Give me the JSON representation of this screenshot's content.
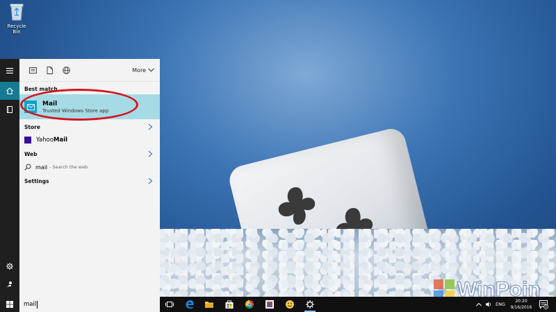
{
  "desktop": {
    "recycle_bin_label": "Recycle Bin",
    "watermark_text": "WinPoin"
  },
  "panel": {
    "more_label": "More",
    "best_match": {
      "section": "Best match",
      "title": "Mail",
      "subtitle": "Trusted Windows Store app"
    },
    "store": {
      "section": "Store",
      "item_prefix": "Yahoo ",
      "item_bold": "Mail"
    },
    "web": {
      "section": "Web",
      "query": "mail",
      "hint": "- Search the web"
    },
    "settings": {
      "section": "Settings"
    }
  },
  "taskbar": {
    "search_value": "mail",
    "language": "ENG",
    "time": "20:20",
    "date": "9/16/2016",
    "notification_count": "6"
  },
  "colors": {
    "accent": "#157b93",
    "best_match_bg": "#a6dbe5",
    "highlight_ring": "#d4141f",
    "app_tile": "#10a1c9"
  }
}
